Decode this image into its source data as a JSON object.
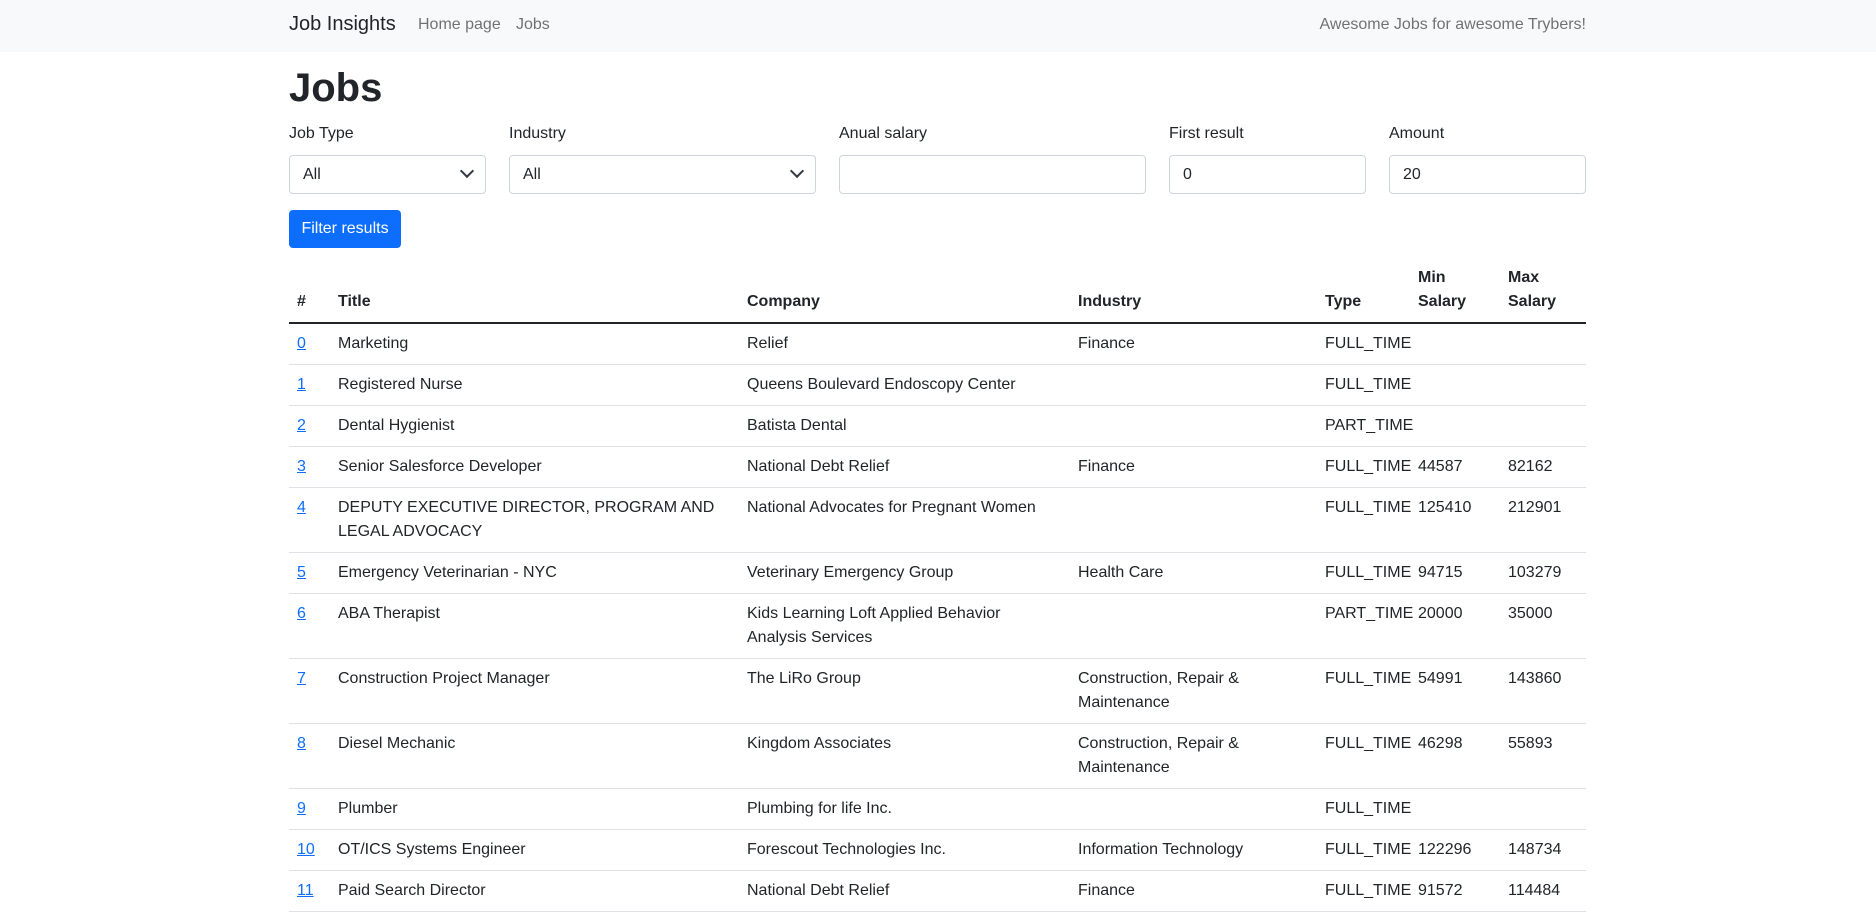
{
  "navbar": {
    "brand": "Job Insights",
    "links": [
      "Home page",
      "Jobs"
    ],
    "tagline": "Awesome Jobs for awesome Trybers!"
  },
  "page": {
    "title": "Jobs"
  },
  "filters": {
    "job_type": {
      "label": "Job Type",
      "selected": "All"
    },
    "industry": {
      "label": "Industry",
      "selected": "All"
    },
    "salary": {
      "label": "Anual salary",
      "value": ""
    },
    "first": {
      "label": "First result",
      "value": "0"
    },
    "amount": {
      "label": "Amount",
      "value": "20"
    },
    "submit_label": "Filter results"
  },
  "table": {
    "headers": [
      "#",
      "Title",
      "Company",
      "Industry",
      "Type",
      "Min Salary",
      "Max Salary"
    ],
    "rows": [
      {
        "id": "0",
        "title": "Marketing",
        "company": "Relief",
        "industry": "Finance",
        "type": "FULL_TIME",
        "min": "",
        "max": ""
      },
      {
        "id": "1",
        "title": "Registered Nurse",
        "company": "Queens Boulevard Endoscopy Center",
        "industry": "",
        "type": "FULL_TIME",
        "min": "",
        "max": ""
      },
      {
        "id": "2",
        "title": "Dental Hygienist",
        "company": "Batista Dental",
        "industry": "",
        "type": "PART_TIME",
        "min": "",
        "max": ""
      },
      {
        "id": "3",
        "title": "Senior Salesforce Developer",
        "company": "National Debt Relief",
        "industry": "Finance",
        "type": "FULL_TIME",
        "min": "44587",
        "max": "82162"
      },
      {
        "id": "4",
        "title": "DEPUTY EXECUTIVE DIRECTOR, PROGRAM AND LEGAL ADVOCACY",
        "company": "National Advocates for Pregnant Women",
        "industry": "",
        "type": "FULL_TIME",
        "min": "125410",
        "max": "212901"
      },
      {
        "id": "5",
        "title": "Emergency Veterinarian - NYC",
        "company": "Veterinary Emergency Group",
        "industry": "Health Care",
        "type": "FULL_TIME",
        "min": "94715",
        "max": "103279"
      },
      {
        "id": "6",
        "title": "ABA Therapist",
        "company": "Kids Learning Loft Applied Behavior Analysis Services",
        "industry": "",
        "type": "PART_TIME",
        "min": "20000",
        "max": "35000"
      },
      {
        "id": "7",
        "title": "Construction Project Manager",
        "company": "The LiRo Group",
        "industry": "Construction, Repair & Maintenance",
        "type": "FULL_TIME",
        "min": "54991",
        "max": "143860"
      },
      {
        "id": "8",
        "title": "Diesel Mechanic",
        "company": "Kingdom Associates",
        "industry": "Construction, Repair & Maintenance",
        "type": "FULL_TIME",
        "min": "46298",
        "max": "55893"
      },
      {
        "id": "9",
        "title": "Plumber",
        "company": "Plumbing for life Inc.",
        "industry": "",
        "type": "FULL_TIME",
        "min": "",
        "max": ""
      },
      {
        "id": "10",
        "title": "OT/ICS Systems Engineer",
        "company": "Forescout Technologies Inc.",
        "industry": "Information Technology",
        "type": "FULL_TIME",
        "min": "122296",
        "max": "148734"
      },
      {
        "id": "11",
        "title": "Paid Search Director",
        "company": "National Debt Relief",
        "industry": "Finance",
        "type": "FULL_TIME",
        "min": "91572",
        "max": "114484"
      }
    ]
  }
}
